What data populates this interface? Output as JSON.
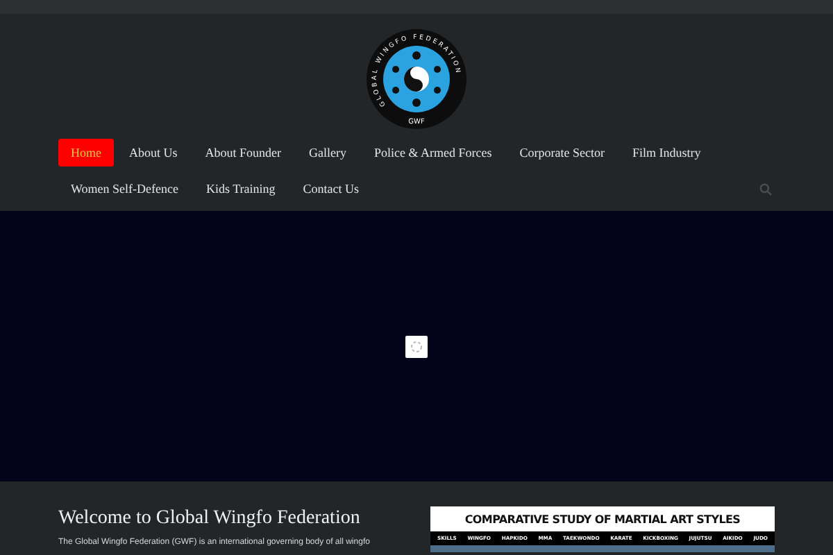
{
  "logo": {
    "ring_text": "GLOBAL WINGFO FEDERATION",
    "abbr": "GWF"
  },
  "nav": {
    "items": [
      {
        "label": "Home",
        "selected": true
      },
      {
        "label": "About Us",
        "selected": false
      },
      {
        "label": "About Founder",
        "selected": false
      },
      {
        "label": "Gallery",
        "selected": false
      },
      {
        "label": "Police & Armed Forces",
        "selected": false
      },
      {
        "label": "Corporate Sector",
        "selected": false
      },
      {
        "label": "Film Industry",
        "selected": false
      },
      {
        "label": "Women Self-Defence",
        "selected": false
      },
      {
        "label": "Kids Training",
        "selected": false
      },
      {
        "label": "Contact Us",
        "selected": false
      }
    ]
  },
  "welcome": {
    "heading": "Welcome to Global Wingfo Federation",
    "text": "The Global Wingfo Federation (GWF) is an international governing body of all wingfo"
  },
  "comparison": {
    "title": "COMPARATIVE STUDY OF MARTIAL ART STYLES",
    "columns": [
      "SKILLS",
      "WINGFO",
      "HAPKIDO",
      "MMA",
      "TAEKWONDO",
      "KARATE",
      "KICKBOXING",
      "JUJUTSU",
      "AIKIDO",
      "JUDO"
    ]
  }
}
